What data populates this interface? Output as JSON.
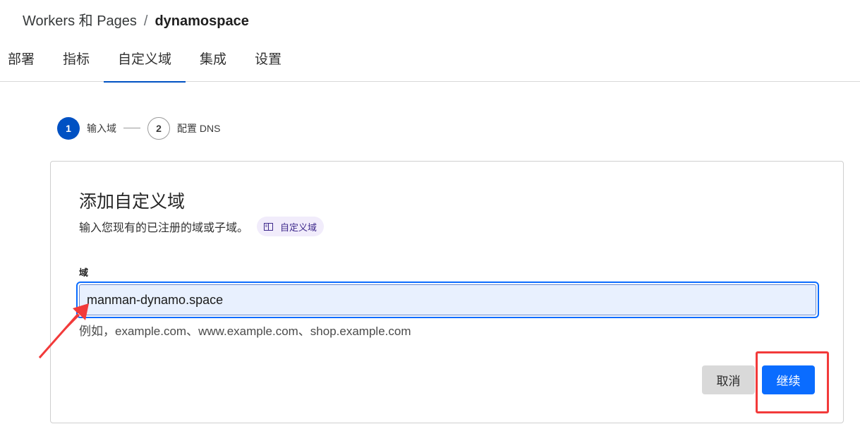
{
  "breadcrumb": {
    "parent": "Workers 和 Pages",
    "separator": "/",
    "current": "dynamospace"
  },
  "tabs": [
    {
      "label": "部署",
      "active": false
    },
    {
      "label": "指标",
      "active": false
    },
    {
      "label": "自定义域",
      "active": true
    },
    {
      "label": "集成",
      "active": false
    },
    {
      "label": "设置",
      "active": false
    }
  ],
  "stepper": {
    "steps": [
      {
        "number": "1",
        "label": "输入域",
        "state": "active"
      },
      {
        "number": "2",
        "label": "配置 DNS",
        "state": "pending"
      }
    ]
  },
  "card": {
    "title": "添加自定义域",
    "description": "输入您现有的已注册的域或子域。",
    "doc_link_label": "自定义域",
    "field_label": "域",
    "field_value": "manman-dynamo.space",
    "helper_text": "例如，example.com、www.example.com、shop.example.com",
    "cancel_label": "取消",
    "continue_label": "继续"
  },
  "colors": {
    "accent": "#0051c3",
    "primary_button": "#0a6cff",
    "annotation": "#f23a3a"
  },
  "icons": {
    "doc_link": "book-icon",
    "annotation_arrow": "arrow-icon"
  }
}
